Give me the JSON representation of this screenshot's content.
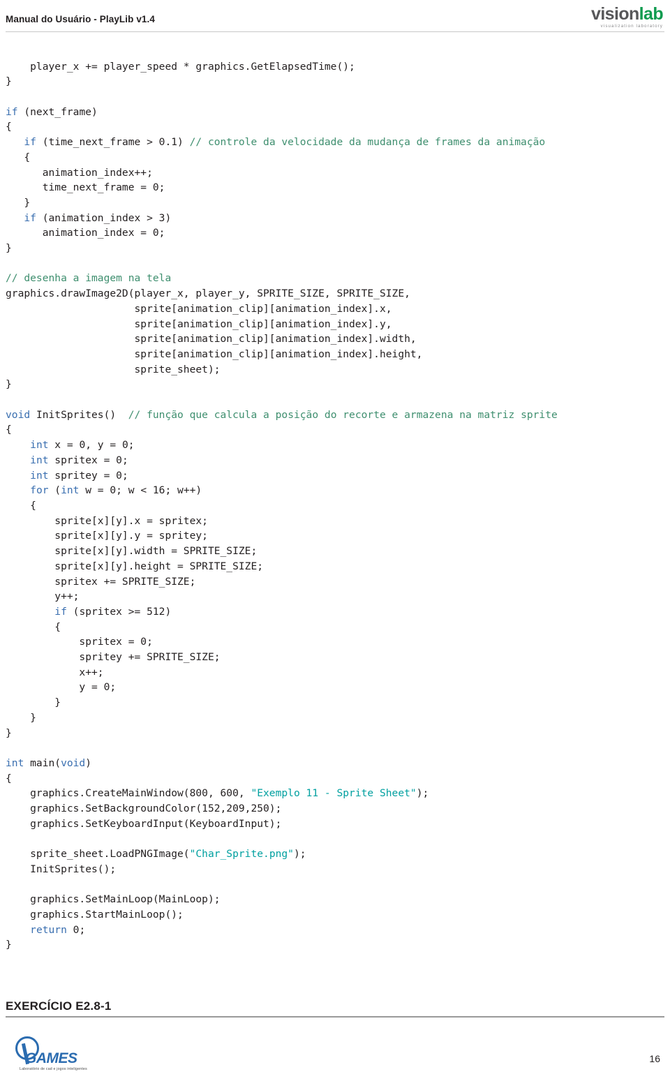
{
  "header": {
    "title": "Manual do Usuário - PlayLib v1.4",
    "logo": {
      "word_part1": "vision",
      "word_part2": "lab",
      "subtitle": "visualization laboratory",
      "color_primary": "#58585a",
      "color_accent": "#0f9b4f"
    }
  },
  "code": {
    "language": "C++",
    "colors": {
      "keyword": "#3a6fb0",
      "comment": "#3f8f6f",
      "string": "#00a0a0",
      "text": "#231f20"
    },
    "lines": [
      "    player_x += player_speed * graphics.GetElapsedTime();",
      "}",
      "",
      "if (next_frame)",
      "{",
      "   if (time_next_frame > 0.1) // controle da velocidade da mudança de frames da animação",
      "   {",
      "      animation_index++;",
      "      time_next_frame = 0;",
      "   }",
      "   if (animation_index > 3)",
      "      animation_index = 0;",
      "}",
      "",
      "// desenha a imagem na tela",
      "graphics.drawImage2D(player_x, player_y, SPRITE_SIZE, SPRITE_SIZE,",
      "                     sprite[animation_clip][animation_index].x,",
      "                     sprite[animation_clip][animation_index].y,",
      "                     sprite[animation_clip][animation_index].width,",
      "                     sprite[animation_clip][animation_index].height,",
      "                     sprite_sheet);",
      "}",
      "",
      "void InitSprites()  // função que calcula a posição do recorte e armazena na matriz sprite",
      "{",
      "    int x = 0, y = 0;",
      "    int spritex = 0;",
      "    int spritey = 0;",
      "    for (int w = 0; w < 16; w++)",
      "    {",
      "        sprite[x][y].x = spritex;",
      "        sprite[x][y].y = spritey;",
      "        sprite[x][y].width = SPRITE_SIZE;",
      "        sprite[x][y].height = SPRITE_SIZE;",
      "        spritex += SPRITE_SIZE;",
      "        y++;",
      "        if (spritex >= 512)",
      "        {",
      "            spritex = 0;",
      "            spritey += SPRITE_SIZE;",
      "            x++;",
      "            y = 0;",
      "        }",
      "    }",
      "}",
      "",
      "int main(void)",
      "{",
      "    graphics.CreateMainWindow(800, 600, \"Exemplo 11 - Sprite Sheet\");",
      "    graphics.SetBackgroundColor(152,209,250);",
      "    graphics.SetKeyboardInput(KeyboardInput);",
      "",
      "    sprite_sheet.LoadPNGImage(\"Char_Sprite.png\");",
      "    InitSprites();",
      "",
      "    graphics.SetMainLoop(MainLoop);",
      "    graphics.StartMainLoop();",
      "    return 0;",
      "}"
    ]
  },
  "exercise": {
    "title": "EXERCÍCIO E2.8-1"
  },
  "footer": {
    "logo_text": "GAMES",
    "logo_subtitle": "Laboratório de cad e jogos inteligentes",
    "page_number": "16"
  }
}
